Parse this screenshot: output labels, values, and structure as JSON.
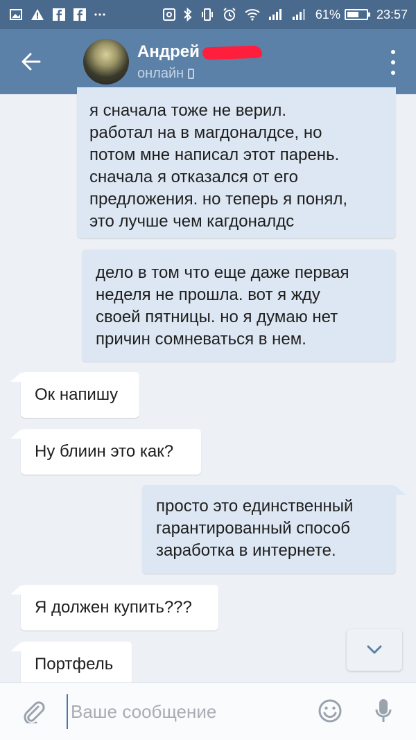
{
  "status_bar": {
    "battery_percent": "61%",
    "time": "23:57",
    "battery_level": 0.61,
    "left_icons": [
      "image-icon",
      "warning-icon",
      "facebook-icon",
      "facebook-icon",
      "more-notifications-icon"
    ],
    "right_icons": [
      "screenshot-icon",
      "bluetooth-icon",
      "vibrate-icon",
      "alarm-icon",
      "wifi-icon",
      "signal-icon",
      "signal-icon"
    ]
  },
  "header": {
    "name": "Андрей",
    "status": "онлайн",
    "colors": {
      "header_bg": "#5b81a8",
      "status_bar_bg": "#4a6a8d",
      "redaction": "#ff1f3c"
    }
  },
  "messages": [
    {
      "direction": "outgoing",
      "lines": [
        "я сначала тоже не верил.",
        "работал на в магдоналдсе, но",
        "потом мне написал этот парень.",
        "сначала я отказался от его",
        "предложения. но теперь я понял,",
        "это лучше чем кагдоналдс"
      ]
    },
    {
      "direction": "outgoing",
      "lines": [
        "дело в том что еще даже первая",
        "неделя не прошла. вот я жду",
        "своей пятницы. но я думаю нет",
        "причин сомневаться в нем."
      ]
    },
    {
      "direction": "incoming",
      "lines": [
        "Ок напишу"
      ]
    },
    {
      "direction": "incoming",
      "lines": [
        "Ну блиин это как?"
      ]
    },
    {
      "direction": "outgoing",
      "lines": [
        "просто это единственный",
        "гарантированный способ",
        "заработка в интернете."
      ]
    },
    {
      "direction": "incoming",
      "lines": [
        "Я должен купить???"
      ]
    },
    {
      "direction": "incoming",
      "lines": [
        "Портфель"
      ]
    }
  ],
  "composer": {
    "placeholder": "Ваше сообщение",
    "value": ""
  }
}
